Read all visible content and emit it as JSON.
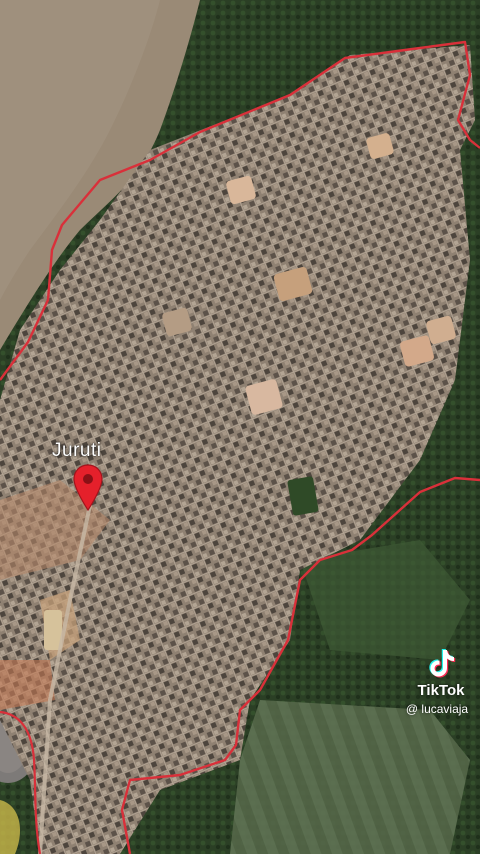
{
  "map": {
    "place_label": "Juruti",
    "pin_icon": "map-pin-icon",
    "boundary_color": "#d9303a",
    "pin_color": "#e5202b",
    "river_color": "#9a8a76",
    "urban_color": "#9c8d7e",
    "forest_color": "#24361f"
  },
  "watermark": {
    "brand": "TikTok",
    "handle": "@ lucaviaja",
    "logo_icon": "tiktok-logo-icon"
  }
}
